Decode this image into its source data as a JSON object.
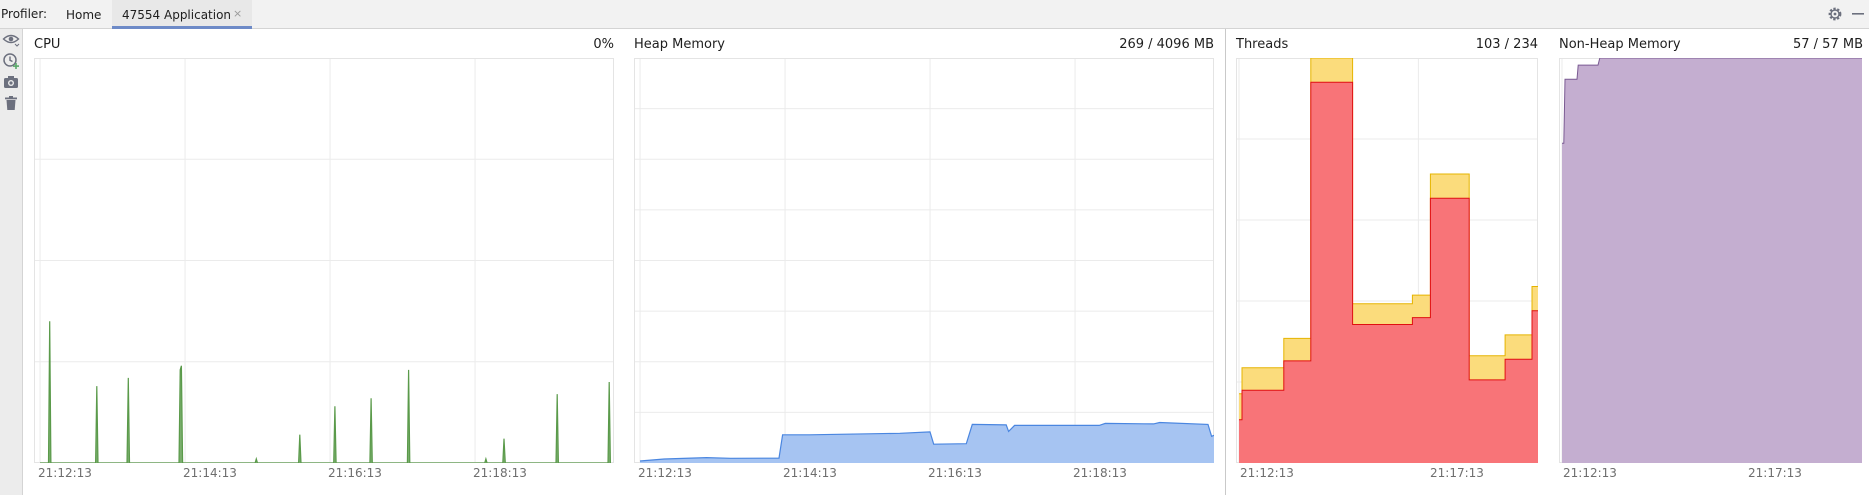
{
  "toolbar": {
    "title": "Profiler:",
    "tabs": [
      {
        "label": "Home",
        "active": false
      },
      {
        "label": "47554 Application",
        "active": true,
        "close": "×"
      }
    ],
    "icons": [
      "gear-icon",
      "minimize-icon"
    ]
  },
  "sidebar": {
    "icons": [
      "eye-icon",
      "clock-add-icon",
      "camera-icon",
      "trash-icon"
    ]
  },
  "colors": {
    "cpu": "#5a9a4a",
    "heap_fill": "#a6c4f2",
    "heap_line": "#4a86e0",
    "threads_total": "#fbdc7c",
    "threads_live": "#f87478",
    "threads_live_line": "#e01010",
    "nonheap": "#c4aed0",
    "nonheap_line": "#7a5a92"
  },
  "panels": {
    "cpu": {
      "title": "CPU",
      "value": "0%",
      "ticks": [
        "21:12:13",
        "21:14:13",
        "21:16:13",
        "21:18:13"
      ]
    },
    "heap": {
      "title": "Heap Memory",
      "value": "269 / 4096 MB",
      "ticks": [
        "21:12:13",
        "21:14:13",
        "21:16:13",
        "21:18:13"
      ]
    },
    "threads": {
      "title": "Threads",
      "value": "103 / 234",
      "ticks": [
        "21:12:13",
        "21:17:13"
      ]
    },
    "nonheap": {
      "title": "Non-Heap Memory",
      "value": "57 / 57 MB",
      "ticks": [
        "21:12:13",
        "21:17:13"
      ]
    }
  },
  "chart_data": [
    {
      "type": "area",
      "title": "CPU",
      "x_unit": "seconds since 21:12:13",
      "xlim": [
        -5,
        475
      ],
      "ylim": [
        0,
        100
      ],
      "grid": true,
      "series": [
        {
          "points": [
            [
              0,
              0
            ],
            [
              7,
              0
            ],
            [
              8,
              35
            ],
            [
              9,
              0
            ],
            [
              46,
              0
            ],
            [
              47,
              19
            ],
            [
              48,
              0
            ],
            [
              72,
              0
            ],
            [
              73,
              21
            ],
            [
              74,
              0
            ],
            [
              115,
              0
            ],
            [
              116,
              23
            ],
            [
              117,
              24
            ],
            [
              118,
              0
            ],
            [
              178,
              0
            ],
            [
              179,
              1
            ],
            [
              180,
              0
            ],
            [
              214,
              0
            ],
            [
              215,
              7
            ],
            [
              216,
              0
            ],
            [
              243,
              0
            ],
            [
              244,
              14
            ],
            [
              245,
              0
            ],
            [
              273,
              0
            ],
            [
              274,
              16
            ],
            [
              275,
              0
            ],
            [
              304,
              0
            ],
            [
              305,
              23
            ],
            [
              306,
              0
            ],
            [
              368,
              0
            ],
            [
              369,
              1
            ],
            [
              370,
              0
            ],
            [
              383,
              0
            ],
            [
              384,
              6
            ],
            [
              385,
              0
            ],
            [
              427,
              0
            ],
            [
              428,
              17
            ],
            [
              429,
              0
            ],
            [
              470,
              0
            ],
            [
              471,
              20
            ],
            [
              472,
              0
            ]
          ]
        }
      ]
    },
    {
      "type": "area",
      "title": "Heap Memory",
      "x_unit": "seconds since 21:12:13",
      "xlim": [
        -5,
        475
      ],
      "ylim": [
        0,
        4096
      ],
      "grid": true,
      "series": [
        {
          "points": [
            [
              0,
              20
            ],
            [
              20,
              40
            ],
            [
              55,
              55
            ],
            [
              75,
              48
            ],
            [
              115,
              50
            ],
            [
              118,
              285
            ],
            [
              140,
              285
            ],
            [
              215,
              300
            ],
            [
              240,
              315
            ],
            [
              243,
              190
            ],
            [
              270,
              195
            ],
            [
              275,
              390
            ],
            [
              303,
              385
            ],
            [
              305,
              320
            ],
            [
              310,
              380
            ],
            [
              380,
              380
            ],
            [
              385,
              400
            ],
            [
              425,
              395
            ],
            [
              430,
              410
            ],
            [
              470,
              390
            ],
            [
              473,
              270
            ],
            [
              475,
              280
            ]
          ]
        }
      ]
    },
    {
      "type": "area",
      "title": "Threads",
      "x_unit": "seconds since 21:12:13",
      "xlim": [
        -5,
        500
      ],
      "ylim": [
        0,
        234
      ],
      "grid": true,
      "series": [
        {
          "points": [
            [
              0,
              40
            ],
            [
              5,
              40
            ],
            [
              5,
              55
            ],
            [
              75,
              55
            ],
            [
              75,
              72
            ],
            [
              120,
              72
            ],
            [
              120,
              234
            ],
            [
              190,
              234
            ],
            [
              190,
              92
            ],
            [
              290,
              92
            ],
            [
              290,
              97
            ],
            [
              320,
              97
            ],
            [
              320,
              167
            ],
            [
              385,
              167
            ],
            [
              385,
              62
            ],
            [
              445,
              62
            ],
            [
              445,
              74
            ],
            [
              490,
              74
            ],
            [
              490,
              102
            ],
            [
              500,
              102
            ]
          ]
        },
        {
          "points": [
            [
              0,
              25
            ],
            [
              5,
              25
            ],
            [
              5,
              42
            ],
            [
              75,
              42
            ],
            [
              75,
              59
            ],
            [
              120,
              59
            ],
            [
              120,
              220
            ],
            [
              190,
              220
            ],
            [
              190,
              80
            ],
            [
              290,
              80
            ],
            [
              290,
              84
            ],
            [
              320,
              84
            ],
            [
              320,
              153
            ],
            [
              385,
              153
            ],
            [
              385,
              48
            ],
            [
              445,
              48
            ],
            [
              445,
              60
            ],
            [
              490,
              60
            ],
            [
              490,
              88
            ],
            [
              500,
              88
            ]
          ]
        }
      ]
    },
    {
      "type": "area",
      "title": "Non-Heap Memory",
      "x_unit": "seconds since 21:12:13",
      "xlim": [
        -5,
        500
      ],
      "ylim": [
        0,
        57
      ],
      "grid": true,
      "series": [
        {
          "points": [
            [
              0,
              45
            ],
            [
              3,
              45
            ],
            [
              5,
              54
            ],
            [
              25,
              54
            ],
            [
              27,
              56
            ],
            [
              60,
              56
            ],
            [
              63,
              57
            ],
            [
              500,
              57
            ]
          ]
        }
      ]
    }
  ]
}
